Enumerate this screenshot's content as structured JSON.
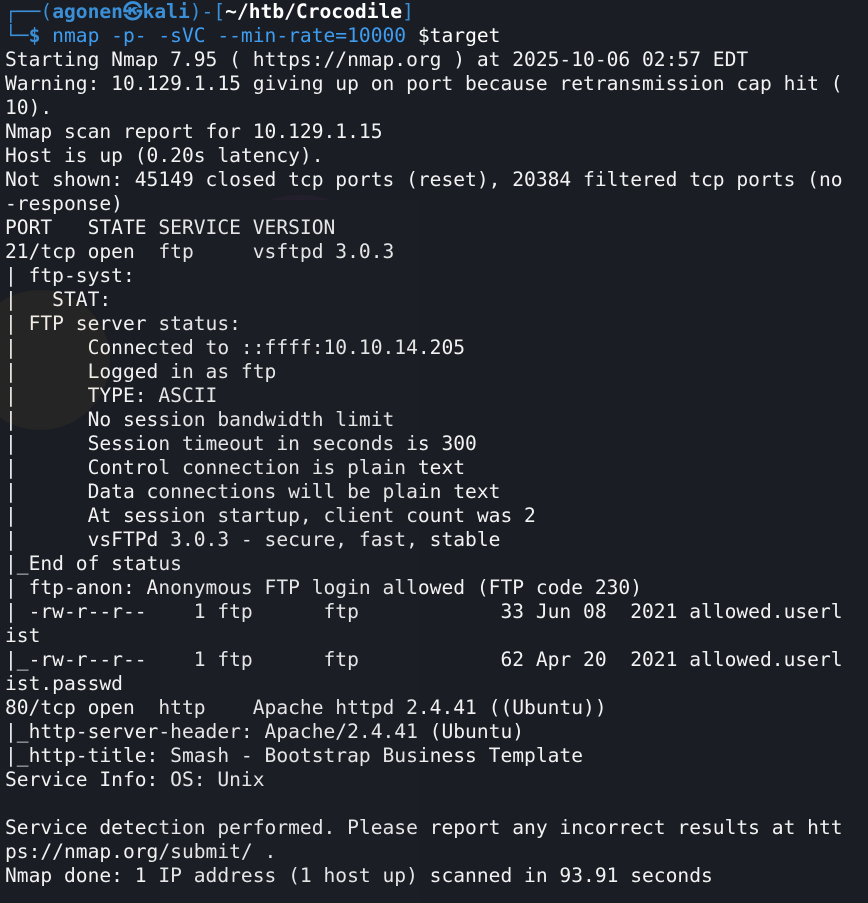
{
  "prompt": {
    "frame_top": "┌──(",
    "user": "agonen",
    "at": "㉿",
    "host": "kali",
    "mid": ")-[",
    "path": "~/htb/Crocodile",
    "end": "]",
    "frame_bottom": "└─",
    "dollar": "$",
    "command": " nmap -p- -sVC --min-rate=10000",
    "var": " $target"
  },
  "output": [
    "Starting Nmap 7.95 ( https://nmap.org ) at 2025-10-06 02:57 EDT",
    "Warning: 10.129.1.15 giving up on port because retransmission cap hit (",
    "10).",
    "Nmap scan report for 10.129.1.15",
    "Host is up (0.20s latency).",
    "Not shown: 45149 closed tcp ports (reset), 20384 filtered tcp ports (no",
    "-response)",
    "PORT   STATE SERVICE VERSION",
    "21/tcp open  ftp     vsftpd 3.0.3",
    "| ftp-syst:",
    "|   STAT:",
    "| FTP server status:",
    "|      Connected to ::ffff:10.10.14.205",
    "|      Logged in as ftp",
    "|      TYPE: ASCII",
    "|      No session bandwidth limit",
    "|      Session timeout in seconds is 300",
    "|      Control connection is plain text",
    "|      Data connections will be plain text",
    "|      At session startup, client count was 2",
    "|      vsFTPd 3.0.3 - secure, fast, stable",
    "|_End of status",
    "| ftp-anon: Anonymous FTP login allowed (FTP code 230)",
    "| -rw-r--r--    1 ftp      ftp            33 Jun 08  2021 allowed.userl",
    "ist",
    "|_-rw-r--r--    1 ftp      ftp            62 Apr 20  2021 allowed.userl",
    "ist.passwd",
    "80/tcp open  http    Apache httpd 2.4.41 ((Ubuntu))",
    "|_http-server-header: Apache/2.4.41 (Ubuntu)",
    "|_http-title: Smash - Bootstrap Business Template",
    "Service Info: OS: Unix",
    "",
    "Service detection performed. Please report any incorrect results at htt",
    "ps://nmap.org/submit/ .",
    "Nmap done: 1 IP address (1 host up) scanned in 93.91 seconds"
  ]
}
